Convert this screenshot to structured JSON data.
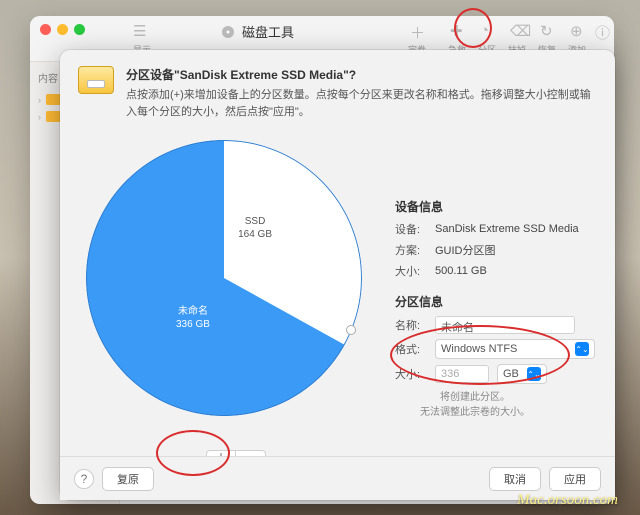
{
  "bg_window": {
    "app_title": "磁盘工具",
    "sidebar_label": "内容",
    "toolbar": {
      "show": "显示",
      "volume": "宗卷",
      "aid": "急救",
      "partition": "分区",
      "erase": "抹掉",
      "restore": "恢复",
      "add": "添加"
    }
  },
  "dialog": {
    "title": "分区设备\"SanDisk Extreme SSD Media\"?",
    "subtitle": "点按添加(+)来增加设备上的分区数量。点按每个分区来更改名称和格式。拖移调整大小控制或输入每个分区的大小，然后点按\"应用\"。",
    "pie": {
      "blue_name": "未命名",
      "blue_size": "336 GB",
      "white_name": "SSD",
      "white_size": "164 GB"
    },
    "add_label": "＋",
    "remove_label": "－",
    "device_info_heading": "设备信息",
    "device_rows": {
      "device_lbl": "设备:",
      "device_val": "SanDisk Extreme SSD Media",
      "scheme_lbl": "方案:",
      "scheme_val": "GUID分区图",
      "size_lbl": "大小:",
      "size_val": "500.11 GB"
    },
    "part_info_heading": "分区信息",
    "part_rows": {
      "name_lbl": "名称:",
      "name_val": "未命名",
      "fmt_lbl": "格式:",
      "fmt_val": "Windows NTFS",
      "size_lbl": "大小:",
      "size_val": "336",
      "size_unit": "GB"
    },
    "note_line1": "将创建此分区。",
    "note_line2": "无法调整此宗卷的大小。",
    "help": "?",
    "revert": "复原",
    "cancel": "取消",
    "apply": "应用"
  },
  "chart_data": {
    "type": "pie",
    "title": "",
    "series": [
      {
        "name": "未命名",
        "value": 336,
        "unit": "GB",
        "color": "#3b9af5"
      },
      {
        "name": "SSD",
        "value": 164,
        "unit": "GB",
        "color": "#ffffff"
      }
    ]
  },
  "watermark": "Mac.orsoon.com"
}
